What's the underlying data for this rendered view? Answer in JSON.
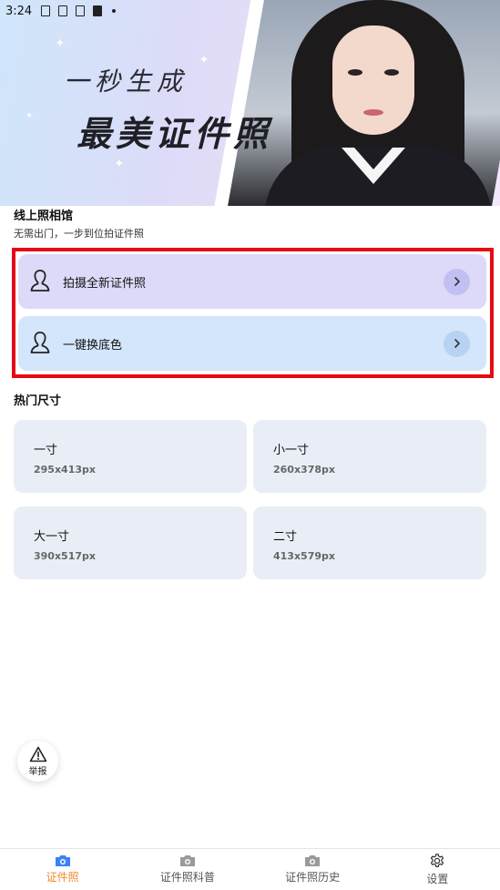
{
  "status_bar": {
    "time": "3:24"
  },
  "banner": {
    "line1": "一秒生成",
    "line2": "最美证件照"
  },
  "intro": {
    "title": "线上照相馆",
    "subtitle": "无需出门，一步到位拍证件照"
  },
  "actions": [
    {
      "label": "拍摄全新证件照",
      "icon": "person-silhouette-icon"
    },
    {
      "label": "一键换底色",
      "icon": "person-silhouette-icon"
    }
  ],
  "hot_sizes": {
    "title": "热门尺寸",
    "items": [
      {
        "name": "一寸",
        "dims": "295x413px"
      },
      {
        "name": "小一寸",
        "dims": "260x378px"
      },
      {
        "name": "大一寸",
        "dims": "390x517px"
      },
      {
        "name": "二寸",
        "dims": "413x579px"
      }
    ]
  },
  "report": {
    "label": "举报",
    "icon": "warning-triangle-icon"
  },
  "bottom_nav": {
    "items": [
      {
        "label": "证件照",
        "icon": "camera-icon",
        "active": true
      },
      {
        "label": "证件照科普",
        "icon": "camera-icon",
        "active": false
      },
      {
        "label": "证件照历史",
        "icon": "camera-icon",
        "active": false
      },
      {
        "label": "设置",
        "icon": "gear-icon",
        "active": false
      }
    ]
  },
  "colors": {
    "highlight_border": "#e50914",
    "action1_bg": "#dcdaf8",
    "action2_bg": "#d3e6fb",
    "card_bg": "#e9eef6",
    "nav_active": "#f08a2c",
    "nav_inactive_icon": "#9a9a9a",
    "camera_active": "#3b82f6"
  }
}
